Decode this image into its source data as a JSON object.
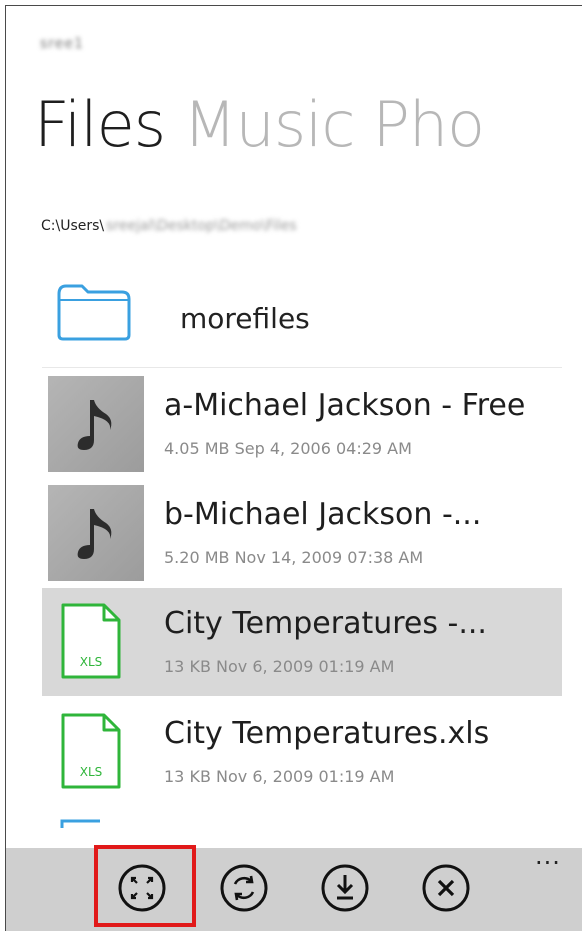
{
  "account": {
    "name": "sree1"
  },
  "pivot": {
    "items": [
      "Files",
      "Music",
      "Pho"
    ],
    "active_index": 0
  },
  "path": {
    "prefix": "C:\\Users\\",
    "blurred": "sreejal\\Desktop\\Demo\\Files"
  },
  "folder": {
    "name": "morefiles",
    "icon": "folder-icon"
  },
  "files": [
    {
      "title": "a-Michael Jackson - Free",
      "meta": "4.05 MB Sep 4, 2006 04:29 AM",
      "icon": "music-note-icon",
      "selected": false
    },
    {
      "title": "b-Michael Jackson -...",
      "meta": "5.20 MB Nov 14, 2009 07:38 AM",
      "icon": "music-note-icon",
      "selected": false
    },
    {
      "title": "City Temperatures -...",
      "meta": "13 KB Nov 6, 2009 01:19 AM",
      "icon": "xls-file-icon",
      "selected": true,
      "badge": "XLS"
    },
    {
      "title": "City Temperatures.xls",
      "meta": "13 KB Nov 6, 2009 01:19 AM",
      "icon": "xls-file-icon",
      "selected": false,
      "badge": "XLS"
    }
  ],
  "appbar": {
    "buttons": [
      "expand-icon",
      "sync-icon",
      "download-icon",
      "close-icon"
    ],
    "more": "..."
  },
  "colors": {
    "xls_green": "#2fb53a",
    "folder_blue": "#3aa0e0",
    "selection": "#d8d8d8",
    "highlight_red": "#e11919"
  }
}
